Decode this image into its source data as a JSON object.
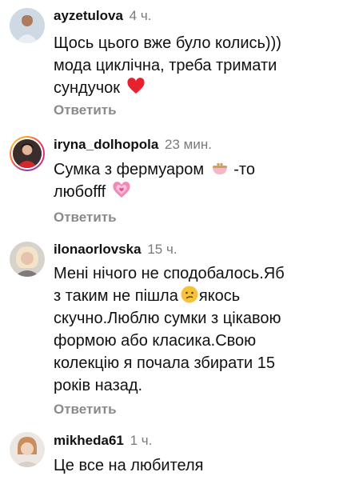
{
  "comments": [
    {
      "username": "ayzetulova",
      "time": "4 ч.",
      "text_lines": [
        "Щось цього вже було колись)))",
        "мода циклічна, треба тримати",
        "сундучок"
      ],
      "emoji": "red-heart-icon",
      "reply": "Ответить"
    },
    {
      "username": "iryna_dolhopola",
      "time": "23 мин.",
      "text_lines": [
        "Сумка з фермуаром",
        "-то",
        "любоfff"
      ],
      "emoji_inline": "purse-icon",
      "emoji": "growing-heart-icon",
      "reply": "Ответить"
    },
    {
      "username": "ilonaorlovska",
      "time": "15 ч.",
      "text_lines": [
        "Мені нічого не сподобалось.Яб",
        "з таким не пішла",
        "якось",
        "скучно.Люблю сумки з цікавою",
        "формою або класика.Свою",
        "колекцію я почала збирати 15",
        "років назад."
      ],
      "emoji_inline": "confused-face-icon",
      "reply": "Ответить"
    },
    {
      "username": "mikheda61",
      "time": "1 ч.",
      "text_lines": [
        "Це все на любителя"
      ]
    }
  ],
  "colors": {
    "background": "#ffffff",
    "text": "#111111",
    "muted": "#8a8a8a"
  }
}
